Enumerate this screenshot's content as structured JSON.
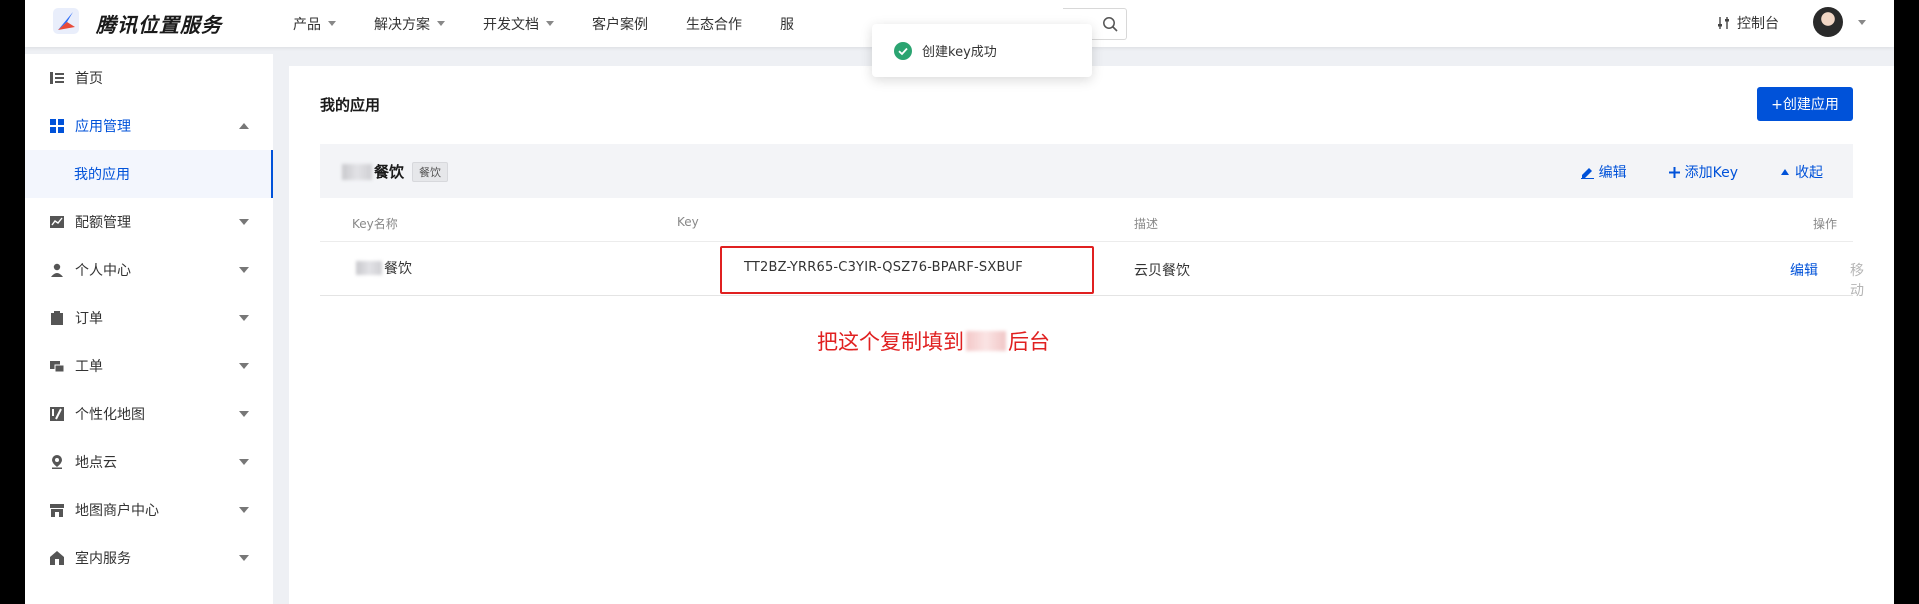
{
  "topbar": {
    "brand": "腾讯位置服务",
    "nav": [
      {
        "label": "产品",
        "has_caret": true
      },
      {
        "label": "解决方案",
        "has_caret": true
      },
      {
        "label": "开发文档",
        "has_caret": true
      },
      {
        "label": "客户案例",
        "has_caret": false
      },
      {
        "label": "生态合作",
        "has_caret": false
      },
      {
        "label": "服",
        "has_caret": false
      }
    ],
    "console_label": "控制台"
  },
  "toast": {
    "text": "创建key成功",
    "icon": "check-circle-icon",
    "color": "#2ba471"
  },
  "sidebar": {
    "items": [
      {
        "label": "首页",
        "icon": "list-icon"
      },
      {
        "label": "应用管理",
        "icon": "grid-icon"
      },
      {
        "label": "我的应用"
      },
      {
        "label": "配额管理",
        "icon": "chart-icon"
      },
      {
        "label": "个人中心",
        "icon": "user-icon"
      },
      {
        "label": "订单",
        "icon": "clipboard-icon"
      },
      {
        "label": "工单",
        "icon": "ticket-icon"
      },
      {
        "label": "个性化地图",
        "icon": "map-style-icon"
      },
      {
        "label": "地点云",
        "icon": "location-pin-icon"
      },
      {
        "label": "地图商户中心",
        "icon": "store-icon"
      },
      {
        "label": "室内服务",
        "icon": "building-icon"
      }
    ]
  },
  "main": {
    "title": "我的应用",
    "create_button": "+创建应用",
    "app": {
      "name_suffix": "餐饮",
      "badge": "餐饮",
      "actions": {
        "edit": "编辑",
        "add_key": "添加Key",
        "collapse": "收起"
      }
    },
    "table": {
      "headers": {
        "name": "Key名称",
        "key": "Key",
        "desc": "描述",
        "ops": "操作"
      },
      "rows": [
        {
          "name_suffix": "餐饮",
          "key": "TT2BZ-YRR65-C3YIR-QSZ76-BPARF-SXBUF",
          "desc": "云贝餐饮",
          "op_edit": "编辑",
          "op_move": "移动"
        }
      ]
    },
    "annotation": {
      "before": "把这个复制填到",
      "after": "后台",
      "color": "#e02020"
    }
  },
  "colors": {
    "accent": "#0052d9",
    "highlight": "#e02020"
  }
}
